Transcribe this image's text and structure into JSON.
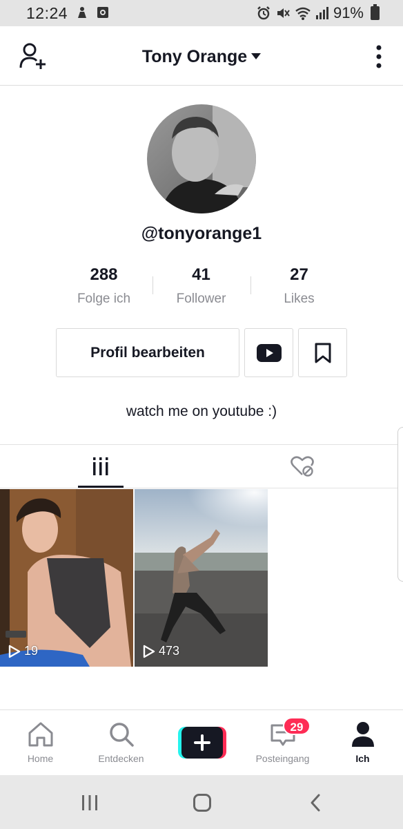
{
  "status_bar": {
    "time": "12:24",
    "battery": "91%"
  },
  "header": {
    "title": "Tony Orange",
    "icons": [
      "add-user-icon",
      "caret-down-icon",
      "more-vertical-icon"
    ]
  },
  "profile": {
    "handle": "@tonyorange1",
    "stats": [
      {
        "value": "288",
        "label": "Folge ich"
      },
      {
        "value": "41",
        "label": "Follower"
      },
      {
        "value": "27",
        "label": "Likes"
      }
    ],
    "edit_button": "Profil bearbeiten",
    "bio": "watch me on youtube :)"
  },
  "tabs": [
    {
      "name": "videos",
      "icon": "grid-bars-icon",
      "active": true
    },
    {
      "name": "liked",
      "icon": "heart-hidden-icon",
      "active": false
    }
  ],
  "videos": [
    {
      "views": "19"
    },
    {
      "views": "473"
    }
  ],
  "bottom_nav": {
    "items": [
      {
        "label": "Home",
        "icon": "home-icon"
      },
      {
        "label": "Entdecken",
        "icon": "search-icon"
      },
      {
        "label": "",
        "icon": "plus-icon"
      },
      {
        "label": "Posteingang",
        "icon": "inbox-icon"
      },
      {
        "label": "Ich",
        "icon": "person-icon"
      }
    ],
    "inbox_badge": "29"
  },
  "colors": {
    "accent_red": "#fe2c55",
    "accent_cyan": "#25f4ee",
    "text_primary": "#161823",
    "text_secondary": "#8a8b91"
  }
}
